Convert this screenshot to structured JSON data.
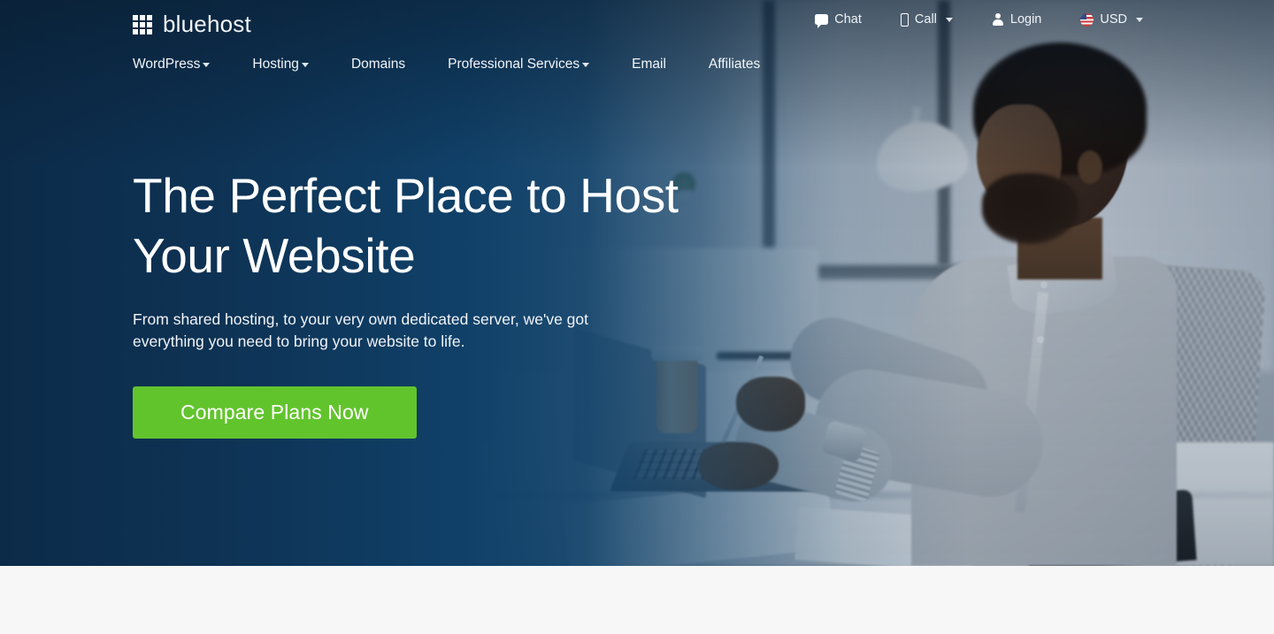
{
  "brand": {
    "name": "bluehost",
    "logo_icon": "grid-icon",
    "accent_green": "#62c42d",
    "hero_blue": "#0f3a63",
    "page_background": "#f7f7f8"
  },
  "header": {
    "utility_nav": [
      {
        "label": "Chat",
        "icon": "chat-bubble-icon",
        "has_caret": false
      },
      {
        "label": "Call",
        "icon": "phone-icon",
        "has_caret": true
      },
      {
        "label": "Login",
        "icon": "user-icon",
        "has_caret": false
      },
      {
        "label": "USD",
        "icon": "us-flag-icon",
        "has_caret": true
      }
    ],
    "main_nav": [
      {
        "label": "WordPress",
        "has_caret": true
      },
      {
        "label": "Hosting",
        "has_caret": true
      },
      {
        "label": "Domains",
        "has_caret": false
      },
      {
        "label": "Professional Services",
        "has_caret": true
      },
      {
        "label": "Email",
        "has_caret": false
      },
      {
        "label": "Affiliates",
        "has_caret": false
      }
    ]
  },
  "hero": {
    "title": "The Perfect Place to Host Your Website",
    "subtitle": "From shared hosting, to your very own dedicated server, we've got everything you need to bring your website to life.",
    "cta_label": "Compare Plans Now",
    "image_alt": "Man working on a laptop at an office desk"
  }
}
